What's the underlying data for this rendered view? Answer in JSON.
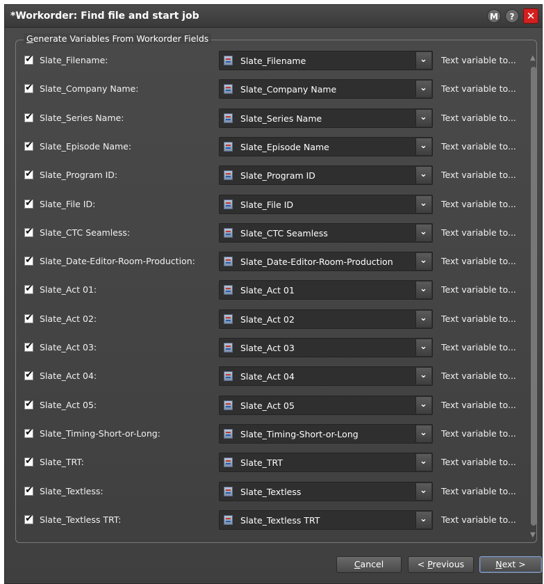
{
  "window": {
    "title": "*Workorder: Find file and start job",
    "buttons": {
      "m": "M",
      "help": "?",
      "close": "✕"
    }
  },
  "group": {
    "legend_first": "G",
    "legend_rest": "enerate Variables From Workorder Fields"
  },
  "rows": [
    {
      "checked": true,
      "label": "Slate_Filename:",
      "value": "Slate_Filename",
      "desc": "Text variable to..."
    },
    {
      "checked": true,
      "label": "Slate_Company Name:",
      "value": "Slate_Company Name",
      "desc": "Text variable to..."
    },
    {
      "checked": true,
      "label": "Slate_Series Name:",
      "value": "Slate_Series Name",
      "desc": "Text variable to..."
    },
    {
      "checked": true,
      "label": "Slate_Episode Name:",
      "value": "Slate_Episode Name",
      "desc": "Text variable to..."
    },
    {
      "checked": true,
      "label": "Slate_Program ID:",
      "value": "Slate_Program ID",
      "desc": "Text variable to..."
    },
    {
      "checked": true,
      "label": "Slate_File ID:",
      "value": "Slate_File ID",
      "desc": "Text variable to..."
    },
    {
      "checked": true,
      "label": "Slate_CTC Seamless:",
      "value": "Slate_CTC Seamless",
      "desc": "Text variable to..."
    },
    {
      "checked": true,
      "label": "Slate_Date-Editor-Room-Production:",
      "value": "Slate_Date-Editor-Room-Production",
      "desc": "Text variable to..."
    },
    {
      "checked": true,
      "label": "Slate_Act 01:",
      "value": "Slate_Act 01",
      "desc": "Text variable to..."
    },
    {
      "checked": true,
      "label": "Slate_Act 02:",
      "value": "Slate_Act 02",
      "desc": "Text variable to..."
    },
    {
      "checked": true,
      "label": "Slate_Act 03:",
      "value": "Slate_Act 03",
      "desc": "Text variable to..."
    },
    {
      "checked": true,
      "label": "Slate_Act 04:",
      "value": "Slate_Act 04",
      "desc": "Text variable to..."
    },
    {
      "checked": true,
      "label": "Slate_Act 05:",
      "value": "Slate_Act 05",
      "desc": "Text variable to..."
    },
    {
      "checked": true,
      "label": "Slate_Timing-Short-or-Long:",
      "value": "Slate_Timing-Short-or-Long",
      "desc": "Text variable to..."
    },
    {
      "checked": true,
      "label": "Slate_TRT:",
      "value": "Slate_TRT",
      "desc": "Text variable to..."
    },
    {
      "checked": true,
      "label": "Slate_Textless:",
      "value": "Slate_Textless",
      "desc": "Text variable to..."
    },
    {
      "checked": true,
      "label": "Slate_Textless TRT:",
      "value": "Slate_Textless TRT",
      "desc": "Text variable to..."
    }
  ],
  "icons": {
    "row_icon": "field-list-icon",
    "dropdown": "chevron-down-icon",
    "checkbox": "checkmark-icon"
  },
  "footer": {
    "cancel_key": "C",
    "cancel_rest": "ancel",
    "prev_prefix": "< ",
    "prev_key": "P",
    "prev_rest": "revious",
    "next_key": "N",
    "next_rest": "ext >"
  },
  "colors": {
    "window_bg": "#444444",
    "close_button": "#d42020",
    "combo_bg": "#2f2f2f"
  }
}
